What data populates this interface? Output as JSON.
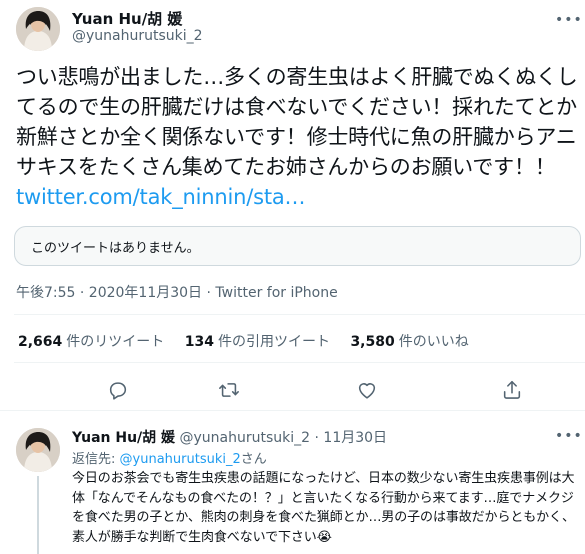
{
  "main_tweet": {
    "author_name": "Yuan Hu/胡 媛",
    "author_handle": "@yunahurutsuki_2",
    "more_label": "•••",
    "text_body": "つい悲鳴が出ました…多くの寄生虫はよく肝臓でぬくぬくしてるので生の肝臓だけは食べないでください！採れたてとか新鮮さとか全く関係ないです！修士時代に魚の肝臓からアニサキスをたくさん集めてたお姉さんからのお願いです！！ ",
    "text_link": "twitter.com/tak_ninnin/sta…",
    "quoted_unavailable": "このツイートはありません。",
    "timestamp": "午後7:55 · 2020年11月30日",
    "source_sep": " · ",
    "source": "Twitter for iPhone",
    "stats": {
      "retweets_count": "2,664",
      "retweets_label": "件のリツイート",
      "quotes_count": "134",
      "quotes_label": "件の引用ツイート",
      "likes_count": "3,580",
      "likes_label": "件のいいね"
    }
  },
  "reply_tweet": {
    "author_name": "Yuan Hu/胡 媛",
    "author_handle": "@yunahurutsuki_2",
    "dot": "·",
    "date": "11月30日",
    "more_label": "•••",
    "reply_to_prefix": "返信先: ",
    "reply_to_handle": "@yunahurutsuki_2",
    "reply_to_suffix": "さん",
    "text": "今日のお茶会でも寄生虫疾患の話題になったけど、日本の数少ない寄生虫疾患事例は大体「なんでそんなもの食べたの！？」と言いたくなる行動から来てます…庭でナメクジを食べた男の子とか、熊肉の刺身を食べた猟師とか…男の子のは事故だからともかく、素人が勝手な判断で生肉食べないで下さい😭"
  },
  "colors": {
    "link": "#1d9bf0",
    "secondary_text": "#536471",
    "border": "#cfd9de"
  },
  "icons": [
    "more-icon",
    "reply-icon",
    "retweet-icon",
    "like-icon",
    "share-icon",
    "avatar"
  ]
}
